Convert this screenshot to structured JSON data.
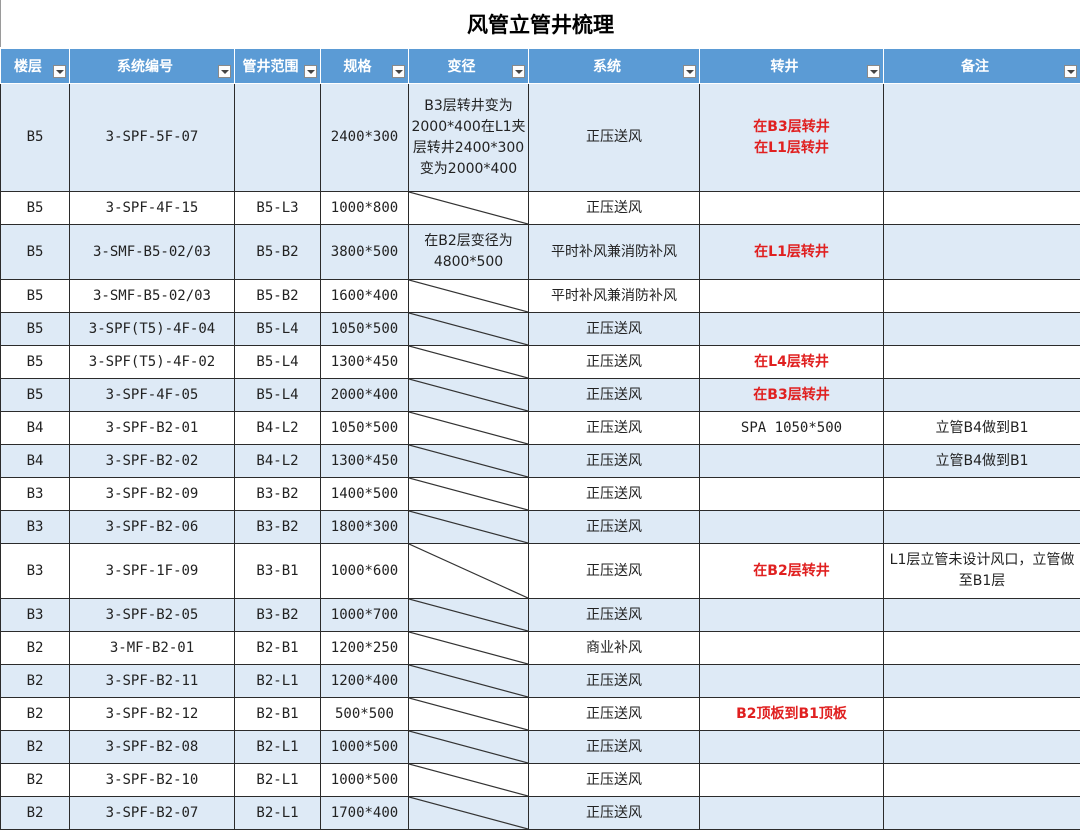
{
  "title": "风管立管井梳理",
  "headers": [
    "楼层",
    "系统编号",
    "管井范围",
    "规格",
    "变径",
    "系统",
    "转井",
    "备注"
  ],
  "rows": [
    {
      "floor": "B5",
      "code": "3-SPF-5F-07",
      "range": "",
      "spec": "2400*300",
      "reducer": "B3层转井变为2000*400在L1夹层转井2400*300变为2000*400",
      "system": "正压送风",
      "transfer": "在B3层转井\n在L1层转井",
      "remark": ""
    },
    {
      "floor": "B5",
      "code": "3-SPF-4F-15",
      "range": "B5-L3",
      "spec": "1000*800",
      "reducer": "",
      "system": "正压送风",
      "transfer": "",
      "remark": ""
    },
    {
      "floor": "B5",
      "code": "3-SMF-B5-02/03",
      "range": "B5-B2",
      "spec": "3800*500",
      "reducer": "在B2层变径为4800*500",
      "system": "平时补风兼消防补风",
      "transfer": "在L1层转井",
      "remark": ""
    },
    {
      "floor": "B5",
      "code": "3-SMF-B5-02/03",
      "range": "B5-B2",
      "spec": "1600*400",
      "reducer": "",
      "system": "平时补风兼消防补风",
      "transfer": "",
      "remark": ""
    },
    {
      "floor": "B5",
      "code": "3-SPF(T5)-4F-04",
      "range": "B5-L4",
      "spec": "1050*500",
      "reducer": "",
      "system": "正压送风",
      "transfer": "",
      "remark": ""
    },
    {
      "floor": "B5",
      "code": "3-SPF(T5)-4F-02",
      "range": "B5-L4",
      "spec": "1300*450",
      "reducer": "",
      "system": "正压送风",
      "transfer": "在L4层转井",
      "remark": ""
    },
    {
      "floor": "B5",
      "code": "3-SPF-4F-05",
      "range": "B5-L4",
      "spec": "2000*400",
      "reducer": "",
      "system": "正压送风",
      "transfer": "在B3层转井",
      "remark": ""
    },
    {
      "floor": "B4",
      "code": "3-SPF-B2-01",
      "range": "B4-L2",
      "spec": "1050*500",
      "reducer": "",
      "system": "正压送风",
      "transfer": "SPA 1050*500",
      "remark": "立管B4做到B1"
    },
    {
      "floor": "B4",
      "code": "3-SPF-B2-02",
      "range": "B4-L2",
      "spec": "1300*450",
      "reducer": "",
      "system": "正压送风",
      "transfer": "",
      "remark": "立管B4做到B1"
    },
    {
      "floor": "B3",
      "code": "3-SPF-B2-09",
      "range": "B3-B2",
      "spec": "1400*500",
      "reducer": "",
      "system": "正压送风",
      "transfer": "",
      "remark": ""
    },
    {
      "floor": "B3",
      "code": "3-SPF-B2-06",
      "range": "B3-B2",
      "spec": "1800*300",
      "reducer": "",
      "system": "正压送风",
      "transfer": "",
      "remark": ""
    },
    {
      "floor": "B3",
      "code": "3-SPF-1F-09",
      "range": "B3-B1",
      "spec": "1000*600",
      "reducer": "",
      "system": "正压送风",
      "transfer": "在B2层转井",
      "remark": "L1层立管未设计风口，立管做至B1层"
    },
    {
      "floor": "B3",
      "code": "3-SPF-B2-05",
      "range": "B3-B2",
      "spec": "1000*700",
      "reducer": "",
      "system": "正压送风",
      "transfer": "",
      "remark": ""
    },
    {
      "floor": "B2",
      "code": "3-MF-B2-01",
      "range": "B2-B1",
      "spec": "1200*250",
      "reducer": "",
      "system": "商业补风",
      "transfer": "",
      "remark": ""
    },
    {
      "floor": "B2",
      "code": "3-SPF-B2-11",
      "range": "B2-L1",
      "spec": "1200*400",
      "reducer": "",
      "system": "正压送风",
      "transfer": "",
      "remark": ""
    },
    {
      "floor": "B2",
      "code": "3-SPF-B2-12",
      "range": "B2-B1",
      "spec": "500*500",
      "reducer": "",
      "system": "正压送风",
      "transfer": "B2顶板到B1顶板",
      "remark": ""
    },
    {
      "floor": "B2",
      "code": "3-SPF-B2-08",
      "range": "B2-L1",
      "spec": "1000*500",
      "reducer": "",
      "system": "正压送风",
      "transfer": "",
      "remark": ""
    },
    {
      "floor": "B2",
      "code": "3-SPF-B2-10",
      "range": "B2-L1",
      "spec": "1000*500",
      "reducer": "",
      "system": "正压送风",
      "transfer": "",
      "remark": ""
    },
    {
      "floor": "B2",
      "code": "3-SPF-B2-07",
      "range": "B2-L1",
      "spec": "1700*400",
      "reducer": "",
      "system": "正压送风",
      "transfer": "",
      "remark": ""
    }
  ],
  "colors": {
    "header_bg": "#5b9bd5",
    "alt_row": "#deeaf6",
    "highlight_text": "#e02020"
  }
}
